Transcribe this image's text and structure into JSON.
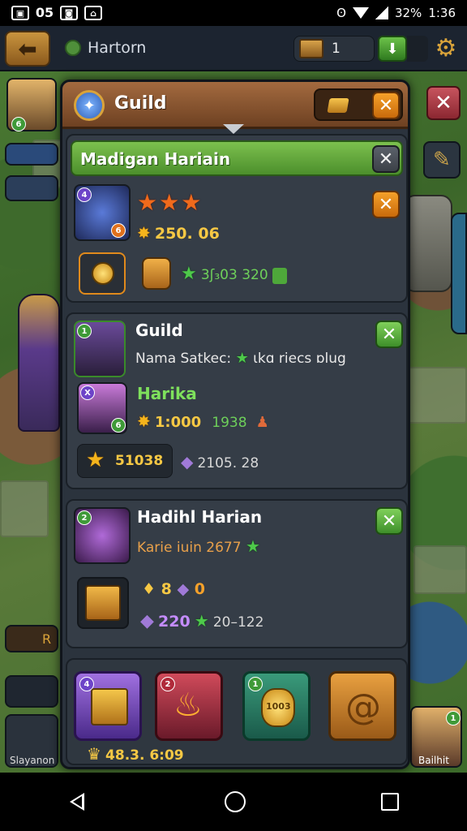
{
  "status_bar": {
    "battery": "32%",
    "time": "1:36",
    "icons": [
      "gallery-icon",
      "o5-icon",
      "photo-icon",
      "camera-icon"
    ]
  },
  "hud": {
    "location": "Hartorn",
    "resource_count": "1",
    "back_icon": "back-arrow-icon",
    "settings_icon": "gear-icon"
  },
  "modal": {
    "title": "Guild",
    "panel1": {
      "banner": "Madigan Hariain",
      "stars": 3,
      "gold": "250. 06",
      "stat_line": "3ʃ₃03 320"
    },
    "panel2": {
      "title": "Guild",
      "line": "Nama Satkec:",
      "line_tail": "ɩkɑ riecs ɒlug",
      "member": "Harika",
      "gold": "1:000",
      "green_val": "1938",
      "star_val": "51038",
      "grey_val": "2105. 28"
    },
    "panel3": {
      "title": "Hadihl Harian",
      "line": "Karie",
      "line_tail": "iuin 2677",
      "small_a": "8",
      "small_b": "0",
      "purple_val": "220",
      "green_val": "20–122"
    },
    "panel4": {
      "timer": "48.3. 6:09",
      "slot3_text": "1003"
    }
  },
  "side": {
    "left_bottom_label": "Slayanon",
    "right_bottom_label": "Bailhit",
    "left_r_label": "R"
  },
  "colors": {
    "hud_bg": "#1c2430",
    "modal_bg": "#2b333d",
    "banner_green": "#7cc04e",
    "close_orange": "#f6a12a",
    "close_green": "#7fd05a",
    "gold": "#f6c844"
  }
}
